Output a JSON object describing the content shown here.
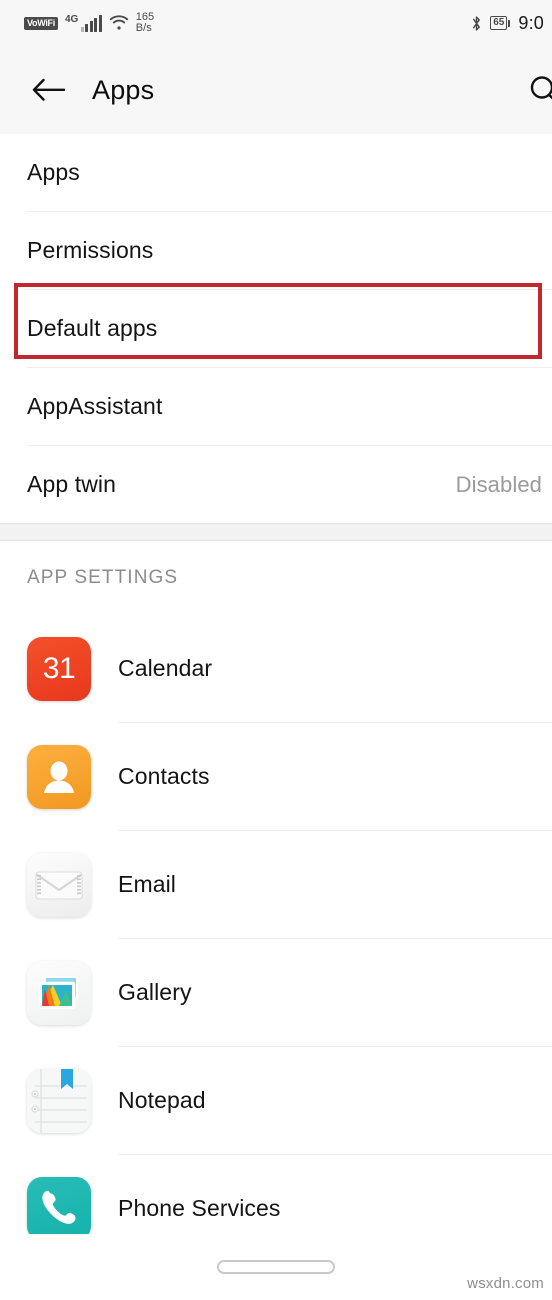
{
  "statusbar": {
    "vowifi_badge": "VoWiFi",
    "network_type": "4G",
    "data_rate_value": "165",
    "data_rate_unit": "B/s",
    "battery_percent": "65",
    "time": "9:0",
    "icons": [
      "signal-bars-icon",
      "wifi-icon",
      "bluetooth-icon",
      "battery-icon"
    ]
  },
  "appbar": {
    "back_label": "back-arrow",
    "title": "Apps",
    "search_label": "search"
  },
  "settings_rows": [
    {
      "label": "Apps",
      "value": ""
    },
    {
      "label": "Permissions",
      "value": ""
    },
    {
      "label": "Default apps",
      "value": "",
      "highlighted": true
    },
    {
      "label": "AppAssistant",
      "value": ""
    },
    {
      "label": "App twin",
      "value": "Disabled"
    }
  ],
  "app_settings": {
    "header": "APP SETTINGS",
    "items": [
      {
        "label": "Calendar",
        "icon": "calendar-icon",
        "icon_text": "31",
        "color": "#e8381d"
      },
      {
        "label": "Contacts",
        "icon": "contacts-icon",
        "color": "#f39820"
      },
      {
        "label": "Email",
        "icon": "email-icon",
        "color": "#ececed"
      },
      {
        "label": "Gallery",
        "icon": "gallery-icon",
        "color": "#eff0f0"
      },
      {
        "label": "Notepad",
        "icon": "notepad-icon",
        "color": "#ebecec"
      },
      {
        "label": "Phone Services",
        "icon": "phone-services-icon",
        "color": "#13b2aa"
      }
    ]
  },
  "annotation": {
    "color": "#c1272d",
    "target": "Default apps"
  },
  "footer": {
    "watermark": "wsxdn.com",
    "nav_pill": "home-gesture-pill"
  }
}
